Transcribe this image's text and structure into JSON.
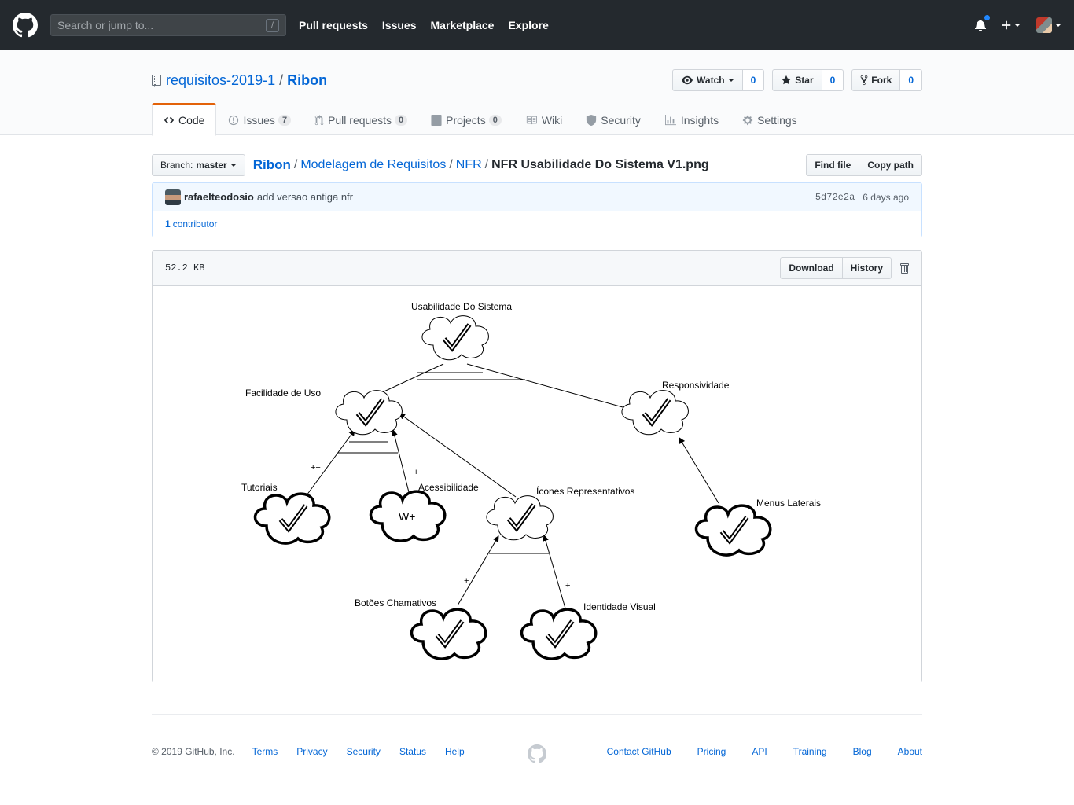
{
  "header": {
    "search_placeholder": "Search or jump to...",
    "search_key": "/",
    "nav": [
      "Pull requests",
      "Issues",
      "Marketplace",
      "Explore"
    ]
  },
  "repo": {
    "owner": "requisitos-2019-1",
    "name": "Ribon",
    "watch_label": "Watch",
    "watch_count": "0",
    "star_label": "Star",
    "star_count": "0",
    "fork_label": "Fork",
    "fork_count": "0"
  },
  "tabs": [
    {
      "label": "Code",
      "icon": "code-icon"
    },
    {
      "label": "Issues",
      "count": "7",
      "icon": "issue-icon"
    },
    {
      "label": "Pull requests",
      "count": "0",
      "icon": "pull-request-icon"
    },
    {
      "label": "Projects",
      "count": "0",
      "icon": "project-icon"
    },
    {
      "label": "Wiki",
      "icon": "book-icon"
    },
    {
      "label": "Security",
      "icon": "shield-icon"
    },
    {
      "label": "Insights",
      "icon": "graph-icon"
    },
    {
      "label": "Settings",
      "icon": "gear-icon"
    }
  ],
  "filenav": {
    "branch_label": "Branch:",
    "branch": "master",
    "breadcrumb": [
      "Ribon",
      "Modelagem de Requisitos",
      "NFR"
    ],
    "file": "NFR Usabilidade Do Sistema V1.png",
    "find_file": "Find file",
    "copy_path": "Copy path"
  },
  "commit": {
    "author": "rafaelteodosio",
    "message": "add versao antiga nfr",
    "sha": "5d72e2a",
    "ago": "6 days ago",
    "contributors_count": "1",
    "contributors_label": "contributor"
  },
  "file": {
    "size": "52.2 KB",
    "download": "Download",
    "history": "History"
  },
  "diagram": {
    "labels": {
      "root": "Usabilidade Do Sistema",
      "facilidade": "Facilidade de Uso",
      "responsividade": "Responsividade",
      "tutoriais": "Tutoriais",
      "acessibilidade": "Acessibilidade",
      "icones": "Ícones Representativos",
      "menus": "Menus Laterais",
      "botoes": "Botões Chamativos",
      "identidade": "Identidade Visual",
      "wplus": "W+"
    },
    "contributions": {
      "tutoriais": "++",
      "acessibilidade": "+",
      "botoes": "+",
      "identidade": "+"
    }
  },
  "footer": {
    "copyright": "© 2019 GitHub, Inc.",
    "left_links": [
      "Terms",
      "Privacy",
      "Security",
      "Status",
      "Help"
    ],
    "right_links": [
      "Contact GitHub",
      "Pricing",
      "API",
      "Training",
      "Blog",
      "About"
    ]
  },
  "colors": {
    "header_bg": "#24292e",
    "link": "#0366d6",
    "tab_accent": "#e36209"
  }
}
